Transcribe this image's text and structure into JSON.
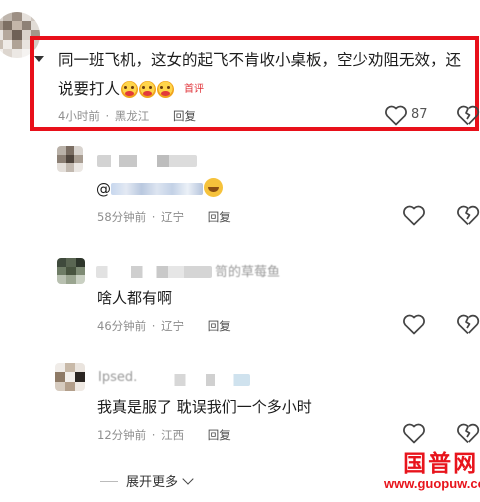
{
  "comment_main": {
    "text": "同一班飞机，这女的起飞不肯收小桌板，空少劝阻无效，还说要打人",
    "badge": "首评",
    "time": "4小时前",
    "location": "黑龙江",
    "reply_label": "回复",
    "like_count": "87"
  },
  "reply_1": {
    "mention": "@",
    "time": "58分钟前",
    "location": "辽宁",
    "reply_label": "回复"
  },
  "reply_2": {
    "author_fragment": "笥的草莓鱼",
    "text": "啥人都有啊",
    "time": "46分钟前",
    "location": "辽宁",
    "reply_label": "回复"
  },
  "reply_3": {
    "author_fragment": "Ӏpsed.",
    "text": "我真是服了 耽误我们一个多小时",
    "time": "12分钟前",
    "location": "江西",
    "reply_label": "回复"
  },
  "expand": {
    "label": "展开更多"
  },
  "watermark": {
    "title": "国普网",
    "url": "www.guopuw.com"
  },
  "colors": {
    "highlight": "#e8101a",
    "badge": "#e0343a",
    "meta": "#8e8e8e"
  },
  "icons": [
    "heart-outline-icon",
    "dislike-broken-heart-icon",
    "chevron-down-icon",
    "emoji-icon"
  ]
}
